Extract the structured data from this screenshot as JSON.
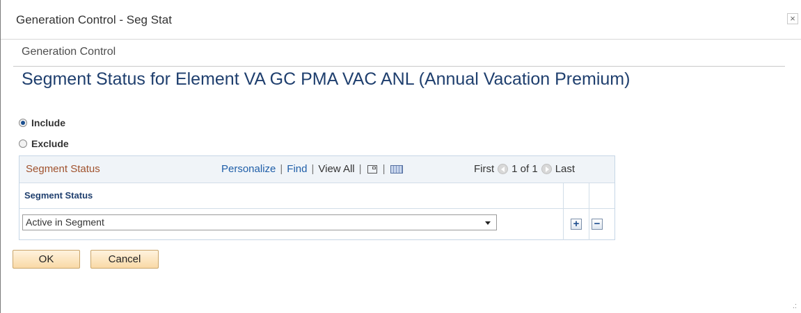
{
  "window": {
    "title": "Generation Control - Seg Stat",
    "close_glyph": "×"
  },
  "page": {
    "subtitle": "Generation Control",
    "heading": "Segment Status for Element VA GC PMA VAC ANL (Annual Vacation Premium)"
  },
  "radios": {
    "include_label": "Include",
    "exclude_label": "Exclude",
    "selected": "Include"
  },
  "grid": {
    "title": "Segment Status",
    "personalize": "Personalize",
    "find": "Find",
    "view_all": "View All",
    "separator": "|",
    "pager": {
      "first": "First",
      "range": "1 of 1",
      "last": "Last"
    },
    "column_header": "Segment Status",
    "rows": [
      {
        "segment_status": "Active in Segment"
      }
    ],
    "add_glyph": "+",
    "delete_glyph": "−"
  },
  "buttons": {
    "ok": "OK",
    "cancel": "Cancel"
  },
  "icons": {
    "close": "close-icon",
    "zoom": "zoom-icon",
    "download": "download-grid-icon",
    "prev": "previous-row-icon",
    "next": "next-row-icon",
    "dropdown": "chevron-down-icon",
    "add": "add-row-icon",
    "delete": "delete-row-icon",
    "resize": "resize-grip-icon"
  },
  "colors": {
    "heading": "#1f3f6e",
    "grid_title": "#a0522d",
    "link": "#1f5ea8",
    "button_bg": "#f9d9a6"
  }
}
